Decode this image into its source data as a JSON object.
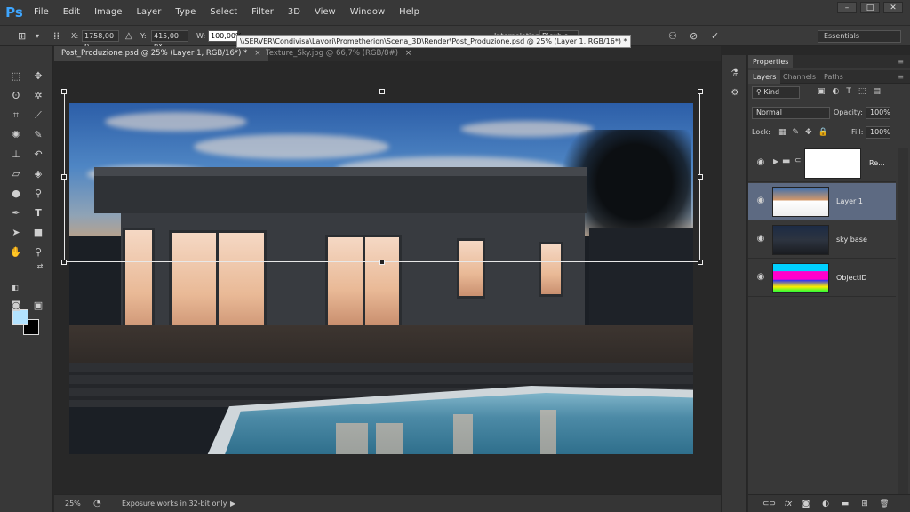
{
  "app": {
    "logo": "Ps",
    "menu": [
      "File",
      "Edit",
      "Image",
      "Layer",
      "Type",
      "Select",
      "Filter",
      "3D",
      "View",
      "Window",
      "Help"
    ],
    "window_controls": [
      "–",
      "□",
      "✕"
    ]
  },
  "options_bar": {
    "x_label": "X:",
    "x_value": "1758,00 p",
    "y_label": "Y:",
    "y_value": "415,00 px",
    "w_label": "W:",
    "w_value": "100,00%",
    "interpolation_label": "Interpolation:",
    "interpolation_value": "Bicubic",
    "tooltip_path": "\\\\SERVER\\Condivisa\\Lavori\\Prometherion\\Scena_3D\\Render\\Post_Produzione.psd @ 25% (Layer 1, RGB/16*) *",
    "workspace": "Essentials"
  },
  "tabs": [
    {
      "label": "Post_Produzione.psd @ 25% (Layer 1, RGB/16*) *",
      "active": true
    },
    {
      "label": "Texture_Sky.jpg @ 66,7% (RGB/8#)",
      "active": false
    }
  ],
  "status": {
    "zoom": "25%",
    "message": "Exposure works in 32-bit only"
  },
  "panels": {
    "properties_tab": "Properties",
    "layer_tabs": [
      "Layers",
      "Channels",
      "Paths"
    ],
    "filter_kind": "Kind",
    "blend_mode": "Normal",
    "opacity_label": "Opacity:",
    "opacity_value": "100%",
    "lock_label": "Lock:",
    "fill_label": "Fill:",
    "fill_value": "100%"
  },
  "layers": [
    {
      "name": "Re...",
      "type": "group",
      "visible": true,
      "selected": false
    },
    {
      "name": "Layer 1",
      "type": "pixel",
      "visible": true,
      "selected": true
    },
    {
      "name": "sky base",
      "type": "pixel",
      "visible": true,
      "selected": false
    },
    {
      "name": "ObjectID",
      "type": "pixel",
      "visible": true,
      "selected": false
    }
  ],
  "colors": {
    "foreground": "#b3e3ff",
    "background": "#000000",
    "selection_highlight": "#5d6a82"
  }
}
